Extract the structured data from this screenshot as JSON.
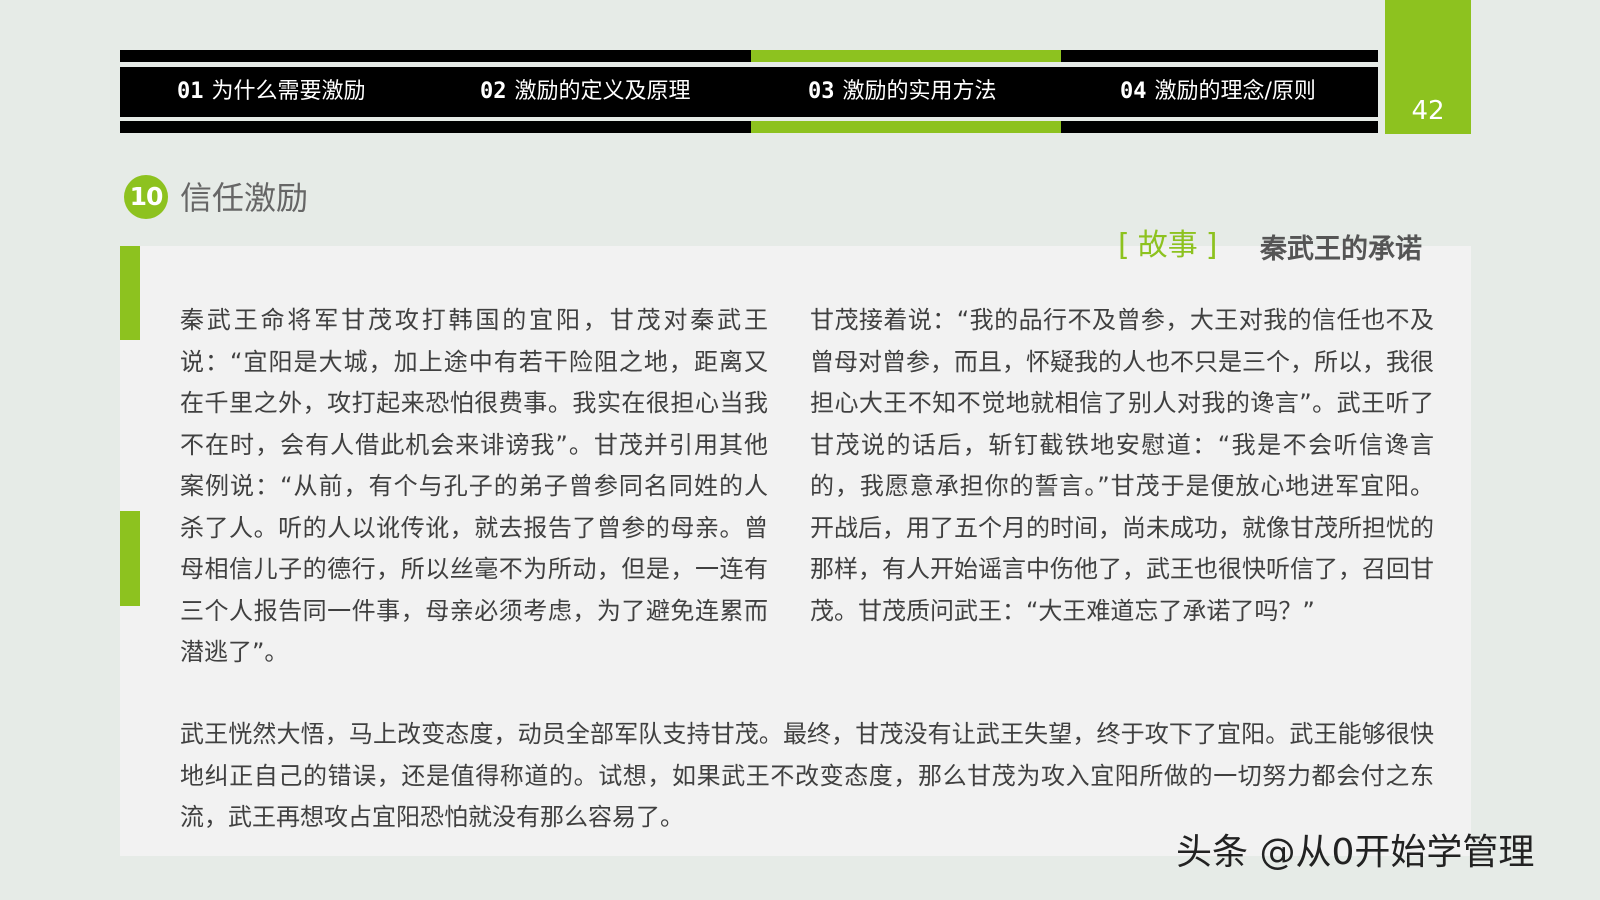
{
  "nav": {
    "tabs": [
      {
        "num": "01",
        "label": "为什么需要激励"
      },
      {
        "num": "02",
        "label": "激励的定义及原理"
      },
      {
        "num": "03",
        "label": "激励的实用方法"
      },
      {
        "num": "04",
        "label": "激励的理念/原则"
      }
    ],
    "active_tab": "03"
  },
  "page_number": "42",
  "section": {
    "number": "10",
    "title": "信任激励"
  },
  "story": {
    "bracket_open": "[",
    "tag": "故事",
    "bracket_close": "]",
    "title": "秦武王的承诺"
  },
  "paragraphs": {
    "left": "秦武王命将军甘茂攻打韩国的宜阳，甘茂对秦武王说：“宜阳是大城，加上途中有若干险阻之地，距离又在千里之外，攻打起来恐怕很费事。我实在很担心当我不在时，会有人借此机会来诽谤我”。甘茂并引用其他案例说：“从前，有个与孔子的弟子曾参同名同姓的人杀了人。听的人以讹传讹，就去报告了曾参的母亲。曾母相信儿子的德行，所以丝毫不为所动，但是，一连有三个人报告同一件事，母亲必须考虑，为了避免连累而潜逃了”。",
    "right": "甘茂接着说：“我的品行不及曾参，大王对我的信任也不及曾母对曾参，而且，怀疑我的人也不只是三个，所以，我很担心大王不知不觉地就相信了别人对我的谗言”。武王听了甘茂说的话后，斩钉截铁地安慰道：“我是不会听信谗言的，我愿意承担你的誓言。”甘茂于是便放心地进军宜阳。 开战后，用了五个月的时间，尚未成功，就像甘茂所担忧的那样，有人开始谣言中伤他了，武王也很快听信了，召回甘茂。甘茂质问武王：“大王难道忘了承诺了吗？”",
    "bottom": "武王恍然大悟，马上改变态度，动员全部军队支持甘茂。最终，甘茂没有让武王失望，终于攻下了宜阳。武王能够很快地纠正自己的错误，还是值得称道的。试想，如果武王不改变态度，那么甘茂为攻入宜阳所做的一切努力都会付之东流，武王再想攻占宜阳恐怕就没有那么容易了。"
  },
  "watermark": "头条 @从0开始学管理",
  "colors": {
    "accent": "#8dc21f",
    "nav_bg": "#000000",
    "panel_bg": "#f2f2f2",
    "page_bg": "#e6ebe7",
    "body_text": "#404040"
  }
}
